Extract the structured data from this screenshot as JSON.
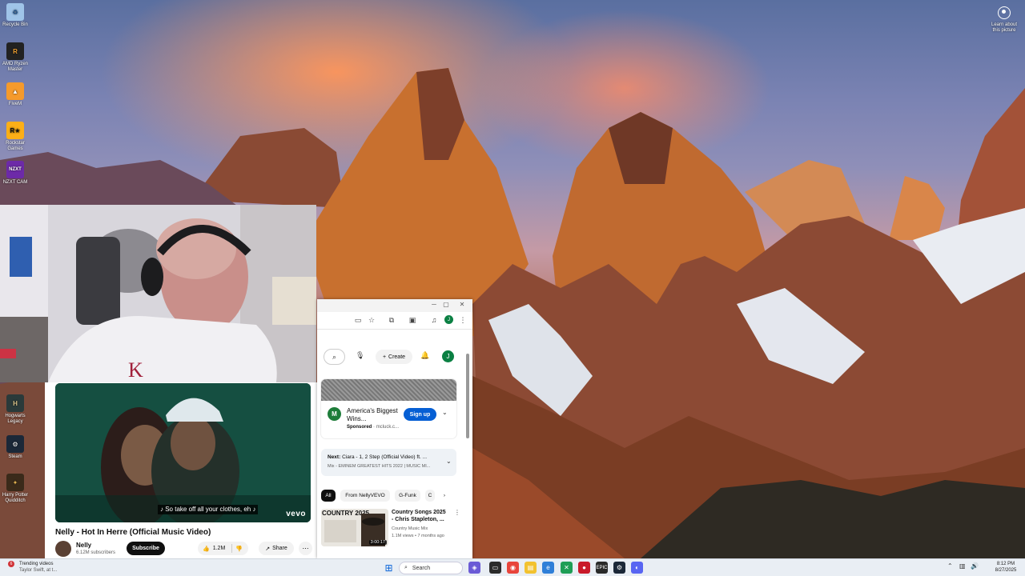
{
  "desktop": {
    "icons": [
      {
        "label": "Recycle Bin"
      },
      {
        "label": "AMD Ryzen Master"
      },
      {
        "label": "FiveM"
      },
      {
        "label": "Rockstar Games"
      },
      {
        "label": "NZXT CAM"
      },
      {
        "label": "Hogwarts Legacy"
      },
      {
        "label": "Steam"
      },
      {
        "label": "Harry Potter Quidditch"
      }
    ],
    "learn_about": "Learn about this picture"
  },
  "video": {
    "caption": "♪ So take off all your clothes, eh ♪",
    "watermark": "vevo",
    "title": "Nelly - Hot In Herre (Official Music Video)",
    "channel": "Nelly",
    "subscribers": "6.12M subscribers",
    "subscribe_label": "Subscribe",
    "likes": "1.2M",
    "share_label": "Share"
  },
  "sidebar": {
    "create_label": "Create",
    "avatar_letter": "J",
    "ad": {
      "logo_letter": "M",
      "title": "America's Biggest Wins...",
      "sponsored": "Sponsored",
      "domain": "mcluck.c...",
      "cta": "Sign up"
    },
    "next": {
      "prefix": "Next:",
      "title": "Ciara - 1, 2 Step (Official Video) ft. ...",
      "subtitle": "Mix - EMINEM GREATEST HITS 2022 | MUSIC MI..."
    },
    "chips": [
      "All",
      "From NellyVEVO",
      "G-Funk",
      "C"
    ],
    "recommendation": {
      "thumb_text": "COUNTRY 2025",
      "duration": "3:00:17",
      "title": "Country Songs 2025 - Chris Stapleton, ...",
      "channel": "Country Music Mix",
      "meta": "1.1M views • 7 months ago"
    }
  },
  "taskbar": {
    "widget_badge": "6",
    "widget_title": "Trending videos",
    "widget_sub": "Taylor Swift, at t...",
    "search_label": "Search",
    "time": "8:12 PM",
    "date": "8/27/2025"
  },
  "colors": {
    "youtube_blue": "#065fd4",
    "avatar_green": "#0b8043"
  }
}
